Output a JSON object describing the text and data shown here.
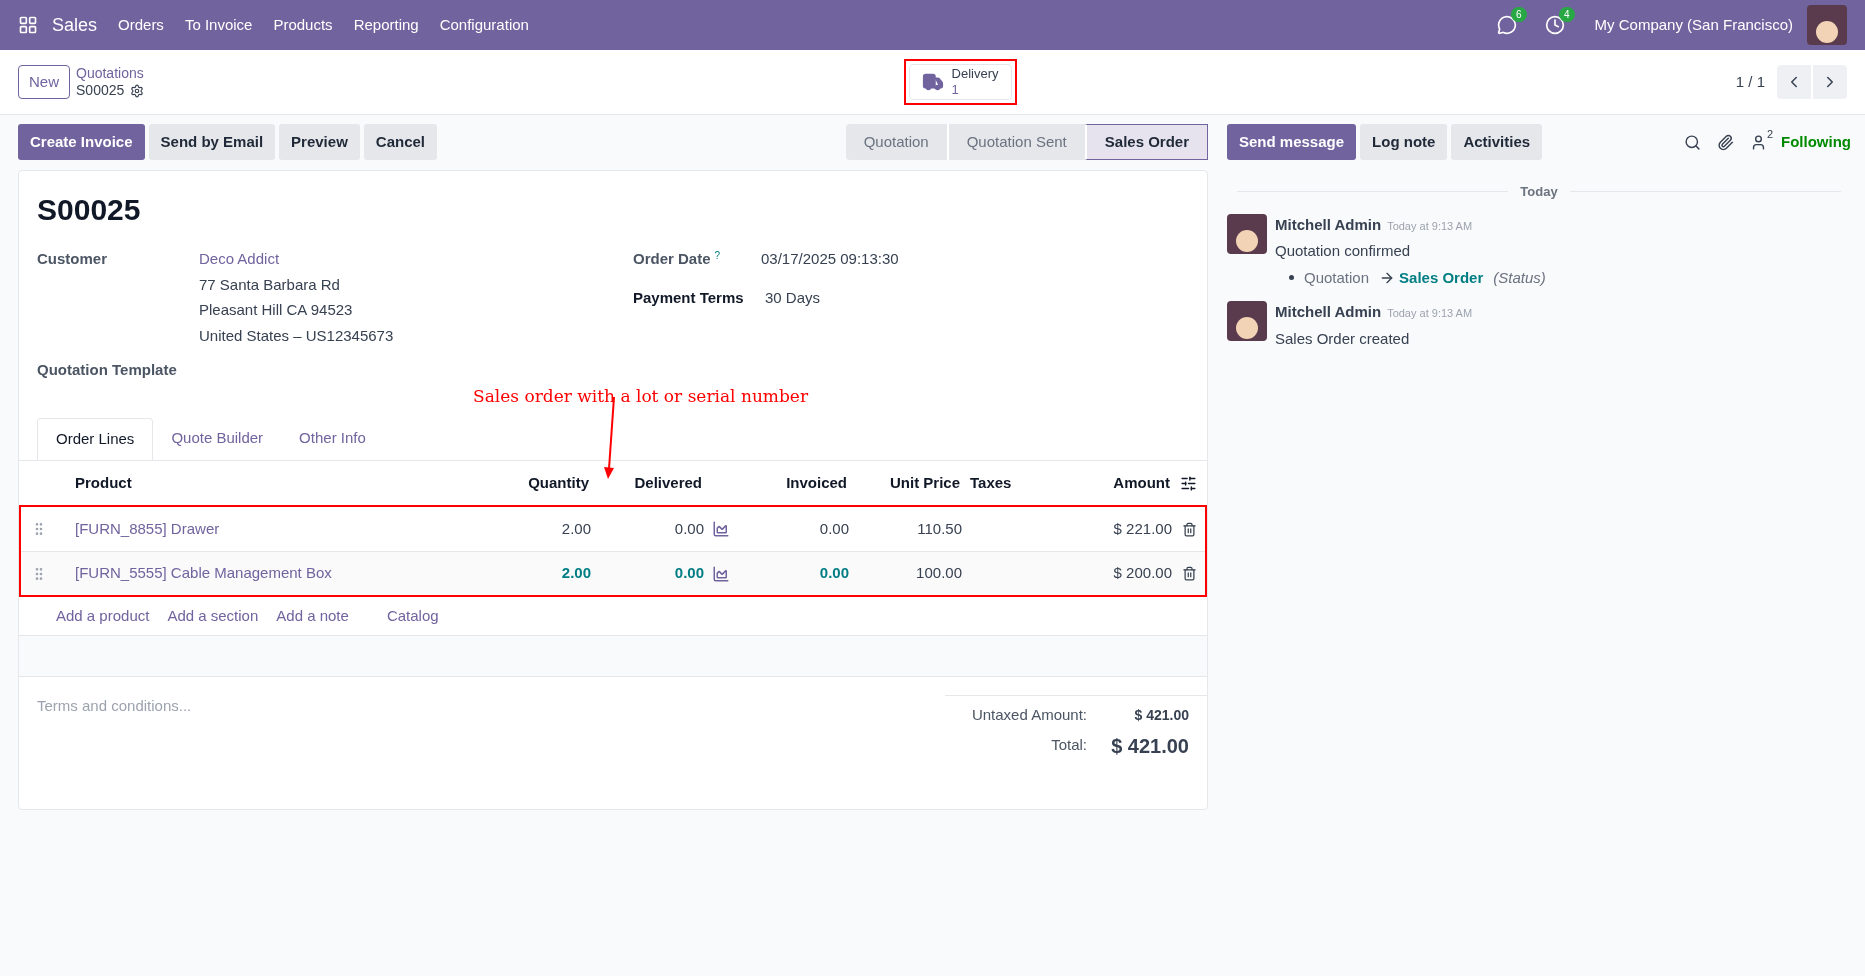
{
  "navbar": {
    "app_name": "Sales",
    "menu": [
      "Orders",
      "To Invoice",
      "Products",
      "Reporting",
      "Configuration"
    ],
    "messages_badge": "6",
    "activities_badge": "4",
    "company": "My Company (San Francisco)"
  },
  "control_panel": {
    "new_button": "New",
    "breadcrumb_parent": "Quotations",
    "record": "S00025",
    "smart_button": {
      "label": "Delivery",
      "count": "1",
      "highlighted": true
    },
    "pager": "1 / 1"
  },
  "action_buttons": [
    {
      "label": "Create Invoice",
      "primary": true
    },
    {
      "label": "Send by Email",
      "primary": false
    },
    {
      "label": "Preview",
      "primary": false
    },
    {
      "label": "Cancel",
      "primary": false
    }
  ],
  "status_steps": [
    {
      "label": "Quotation",
      "selected": false
    },
    {
      "label": "Quotation Sent",
      "selected": false
    },
    {
      "label": "Sales Order",
      "selected": true
    }
  ],
  "form": {
    "title": "S00025",
    "customer_label": "Customer",
    "customer_name": "Deco Addict",
    "customer_address": [
      "77 Santa Barbara Rd",
      "Pleasant Hill CA 94523",
      "United States – US12345673"
    ],
    "order_date_label": "Order Date",
    "order_date_help": "?",
    "order_date": "03/17/2025 09:13:30",
    "payment_terms_label": "Payment Terms",
    "payment_terms": "30 Days",
    "template_label": "Quotation Template"
  },
  "annotation": {
    "text": "Sales order with a lot or serial number"
  },
  "tabs": [
    {
      "label": "Order Lines",
      "selected": true
    },
    {
      "label": "Quote Builder",
      "selected": false
    },
    {
      "label": "Other Info",
      "selected": false
    }
  ],
  "table": {
    "columns": [
      "Product",
      "Quantity",
      "Delivered",
      "Invoiced",
      "Unit Price",
      "Taxes",
      "Amount"
    ],
    "highlighted": true,
    "rows": [
      {
        "product": "[FURN_8855] Drawer",
        "quantity": "2.00",
        "delivered": "0.00",
        "invoiced": "0.00",
        "unit_price": "110.50",
        "amount": "$ 221.00",
        "emphasized": false
      },
      {
        "product": "[FURN_5555] Cable Management Box",
        "quantity": "2.00",
        "delivered": "0.00",
        "invoiced": "0.00",
        "unit_price": "100.00",
        "amount": "$ 200.00",
        "emphasized": true
      }
    ],
    "add_links": [
      "Add a product",
      "Add a section",
      "Add a note",
      "Catalog"
    ]
  },
  "terms_placeholder": "Terms and conditions...",
  "totals": {
    "untaxed_label": "Untaxed Amount:",
    "untaxed_value": "$ 421.00",
    "total_label": "Total:",
    "total_value": "$ 421.00"
  },
  "chatter": {
    "buttons": [
      {
        "label": "Send message",
        "primary": true
      },
      {
        "label": "Log note",
        "primary": false
      },
      {
        "label": "Activities",
        "primary": false
      }
    ],
    "followers_count": "2",
    "following": "Following",
    "date_separator": "Today",
    "messages": [
      {
        "author": "Mitchell Admin",
        "time": "Today at 9:13 AM",
        "body": "Quotation confirmed",
        "changes": [
          {
            "old": "Quotation",
            "new": "Sales Order",
            "field": "(Status)"
          }
        ]
      },
      {
        "author": "Mitchell Admin",
        "time": "Today at 9:13 AM",
        "body": "Sales Order created"
      }
    ]
  }
}
